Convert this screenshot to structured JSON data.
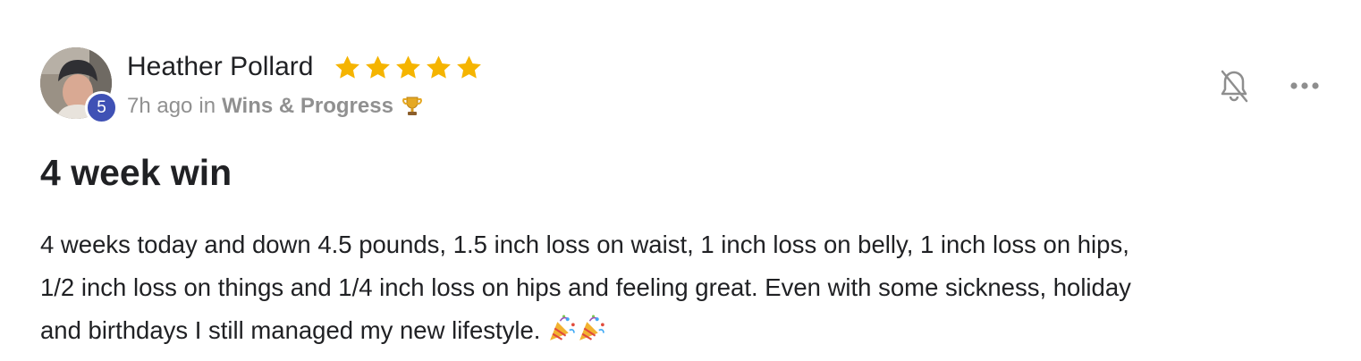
{
  "post": {
    "author": {
      "name": "Heather Pollard",
      "level": "5",
      "rating_stars": 5
    },
    "meta": {
      "time_ago": "7h ago",
      "in_text": "in",
      "category": "Wins & Progress"
    },
    "title": "4 week win",
    "body_lines": [
      "4 weeks today and down 4.5 pounds, 1.5 inch loss on waist, 1 inch loss on belly, 1 inch loss on hips,",
      "1/2 inch loss on things and 1/4 inch loss on hips and feeling great. Even with some sickness, holiday",
      "and birthdays I still managed my new lifestyle."
    ],
    "icons": {
      "bell": "bell-off-icon",
      "more": "more-horizontal-icon",
      "trophy": "trophy-icon",
      "party": "party-popper-icon",
      "star": "star-icon"
    },
    "colors": {
      "star": "#F5B400",
      "level_badge": "#3F51B5",
      "meta_text": "#909090",
      "icon_gray": "#8E8E8E"
    }
  }
}
